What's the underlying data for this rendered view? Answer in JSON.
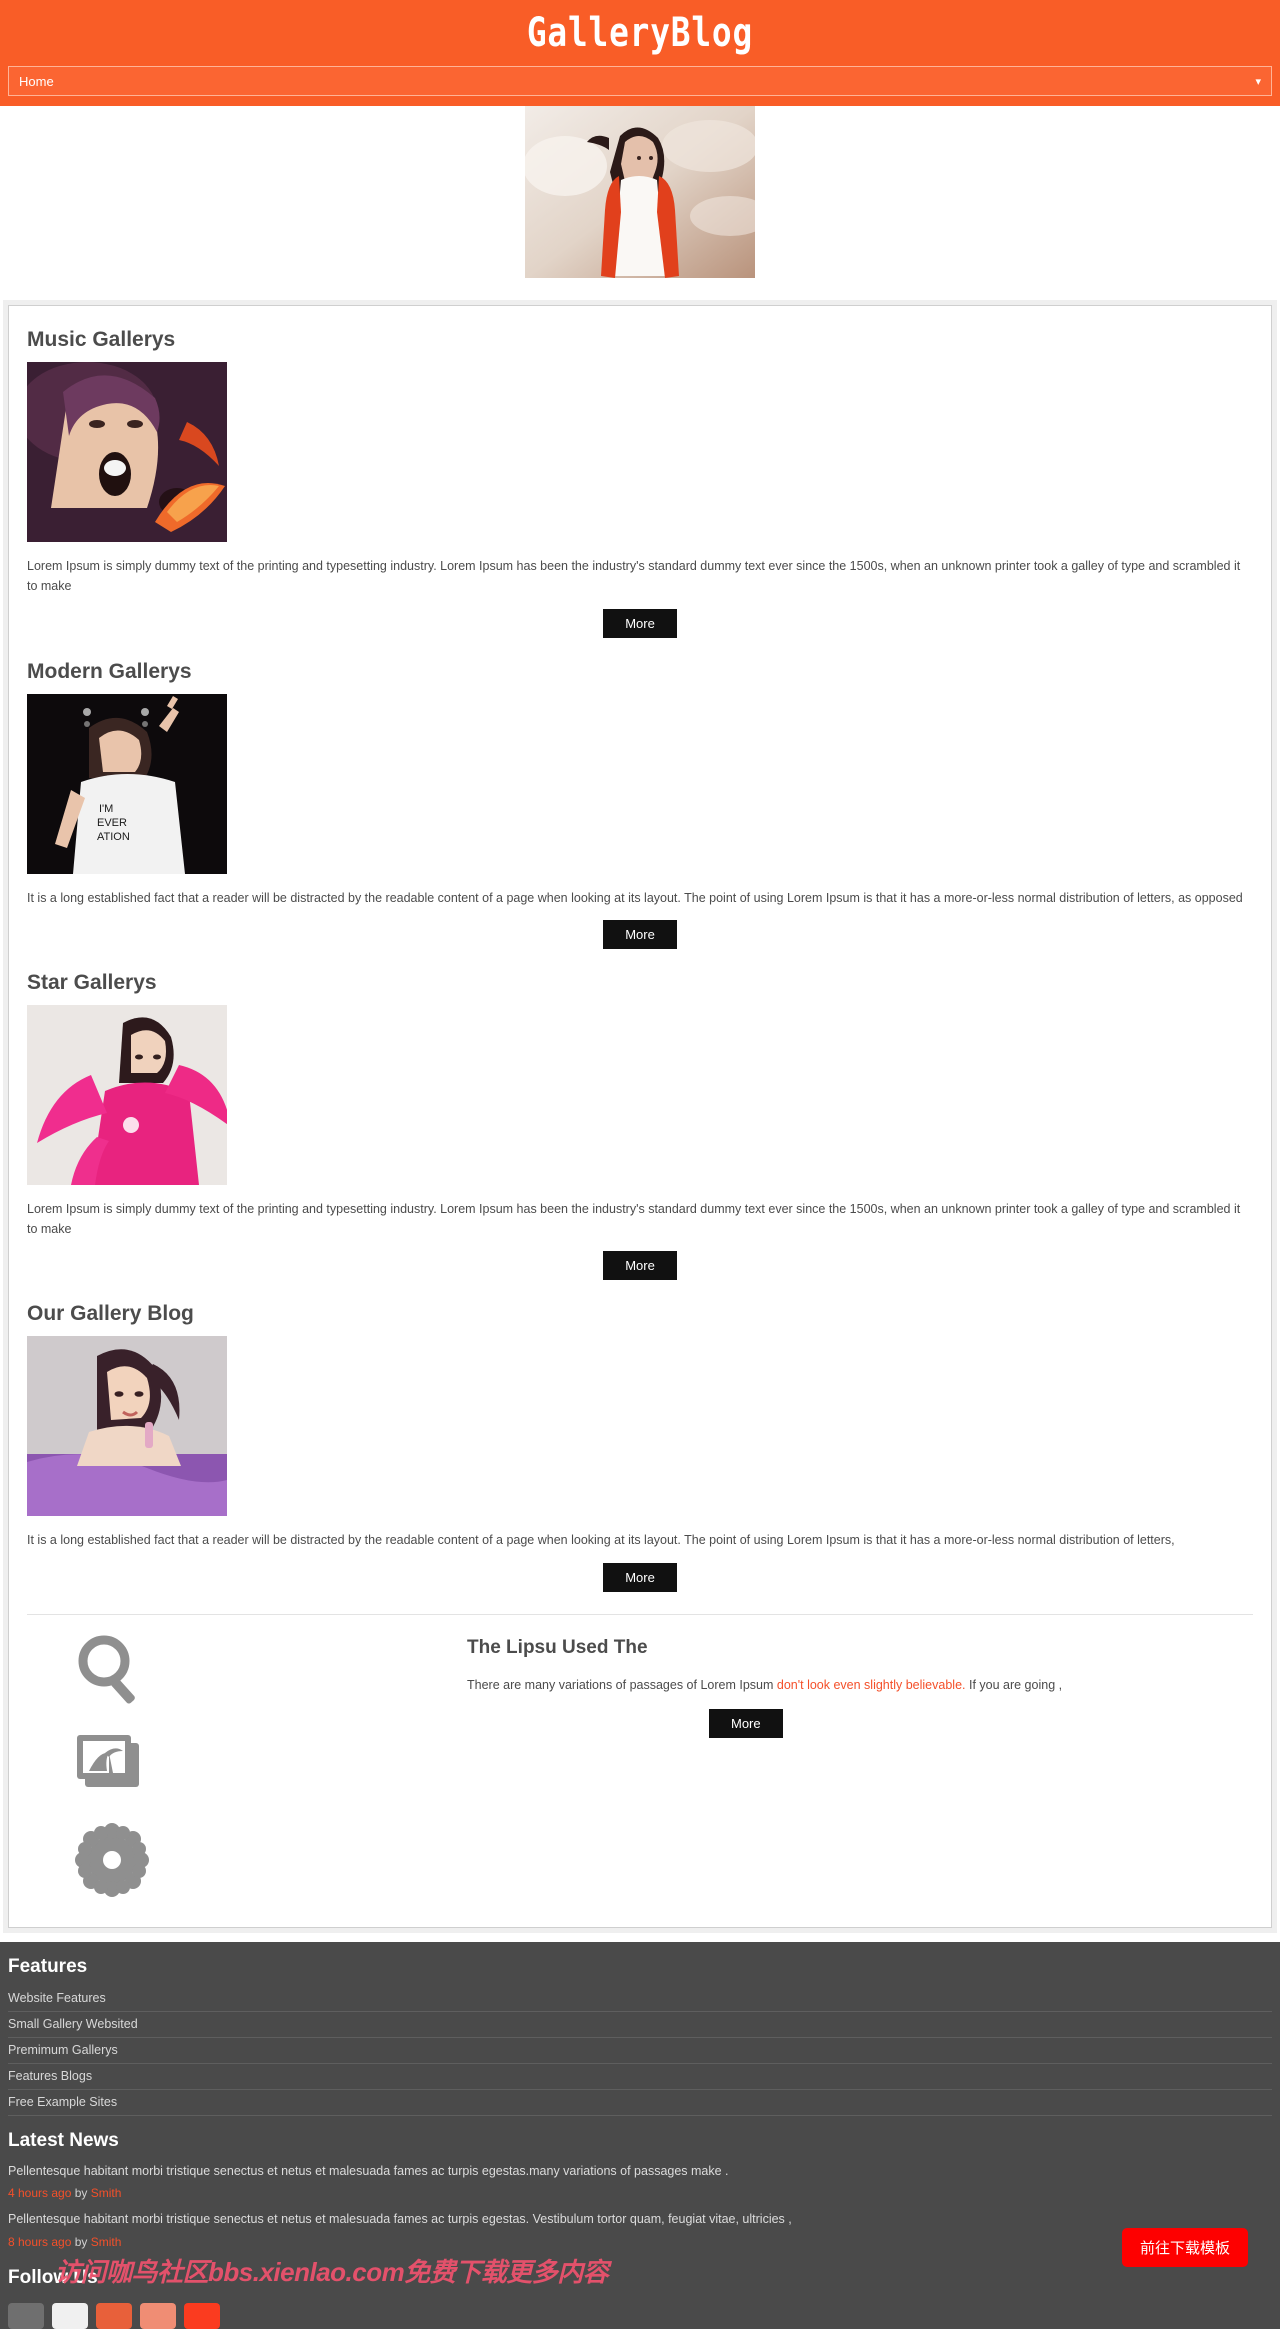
{
  "header": {
    "brand": "GalleryBlog",
    "nav": {
      "selected": "Home",
      "chevron": "chevron-down-icon"
    }
  },
  "hero": {
    "alt": "fashion-model-hero"
  },
  "sections": [
    {
      "title": "Music Gallerys",
      "text": "Lorem Ipsum is simply dummy text of the printing and typesetting industry. Lorem Ipsum has been the industry's standard dummy text ever since the 1500s, when an unknown printer took a galley of type and scrambled it to make",
      "more": "More",
      "thumb": "music-gallery-thumb"
    },
    {
      "title": "Modern Gallerys",
      "text": "It is a long established fact that a reader will be distracted by the readable content of a page when looking at its layout. The point of using Lorem Ipsum is that it has a more-or-less normal distribution of letters, as opposed",
      "more": "More",
      "thumb": "modern-gallery-thumb"
    },
    {
      "title": "Star Gallerys",
      "text": "Lorem Ipsum is simply dummy text of the printing and typesetting industry. Lorem Ipsum has been the industry's standard dummy text ever since the 1500s, when an unknown printer took a galley of type and scrambled it to make",
      "more": "More",
      "thumb": "star-gallery-thumb"
    },
    {
      "title": "Our Gallery Blog",
      "text": "It is a long established fact that a reader will be distracted by the readable content of a page when looking at its layout. The point of using Lorem Ipsum is that it has a more-or-less normal distribution of letters,",
      "more": "More",
      "thumb": "our-gallery-blog-thumb"
    }
  ],
  "feature_block": {
    "icons": [
      "search-icon",
      "photos-icon",
      "gear-icon"
    ],
    "title": "The Lipsu Used The",
    "text_before": "There are many variations of passages of Lorem Ipsum ",
    "text_highlight": "don't look even slightly believable.",
    "text_after": " If you are going ,",
    "more": "More"
  },
  "footer": {
    "features_title": "Features",
    "features": [
      "Website Features",
      "Small Gallery Websited",
      "Premimum Gallerys",
      "Features Blogs",
      "Free Example Sites"
    ],
    "news_title": "Latest News",
    "news": [
      {
        "text": "Pellentesque habitant morbi tristique senectus et netus et malesuada fames ac turpis egestas.many variations of passages make .",
        "time": "4 hours ago",
        "by": " by ",
        "author": "Smith"
      },
      {
        "text": "Pellentesque habitant morbi tristique senectus et netus et malesuada fames ac turpis egestas. Vestibulum tortor quam, feugiat vitae, ultricies ,",
        "time": "8 hours ago",
        "by": " by ",
        "author": "Smith"
      }
    ],
    "follow_title": "Follow Us",
    "social": [
      "social-icon-1",
      "social-icon-2",
      "social-icon-3",
      "social-icon-4",
      "social-icon-5"
    ],
    "watermark": "访问咖鸟社区bbs.xienlao.com免费下载更多内容",
    "download_button": "前往下载模板"
  },
  "colors": {
    "brand_orange": "#f95d27",
    "accent_orange": "#f4502a",
    "footer_bg": "#4a4a4a",
    "button_black": "#111111",
    "download_red": "#fe0000"
  }
}
